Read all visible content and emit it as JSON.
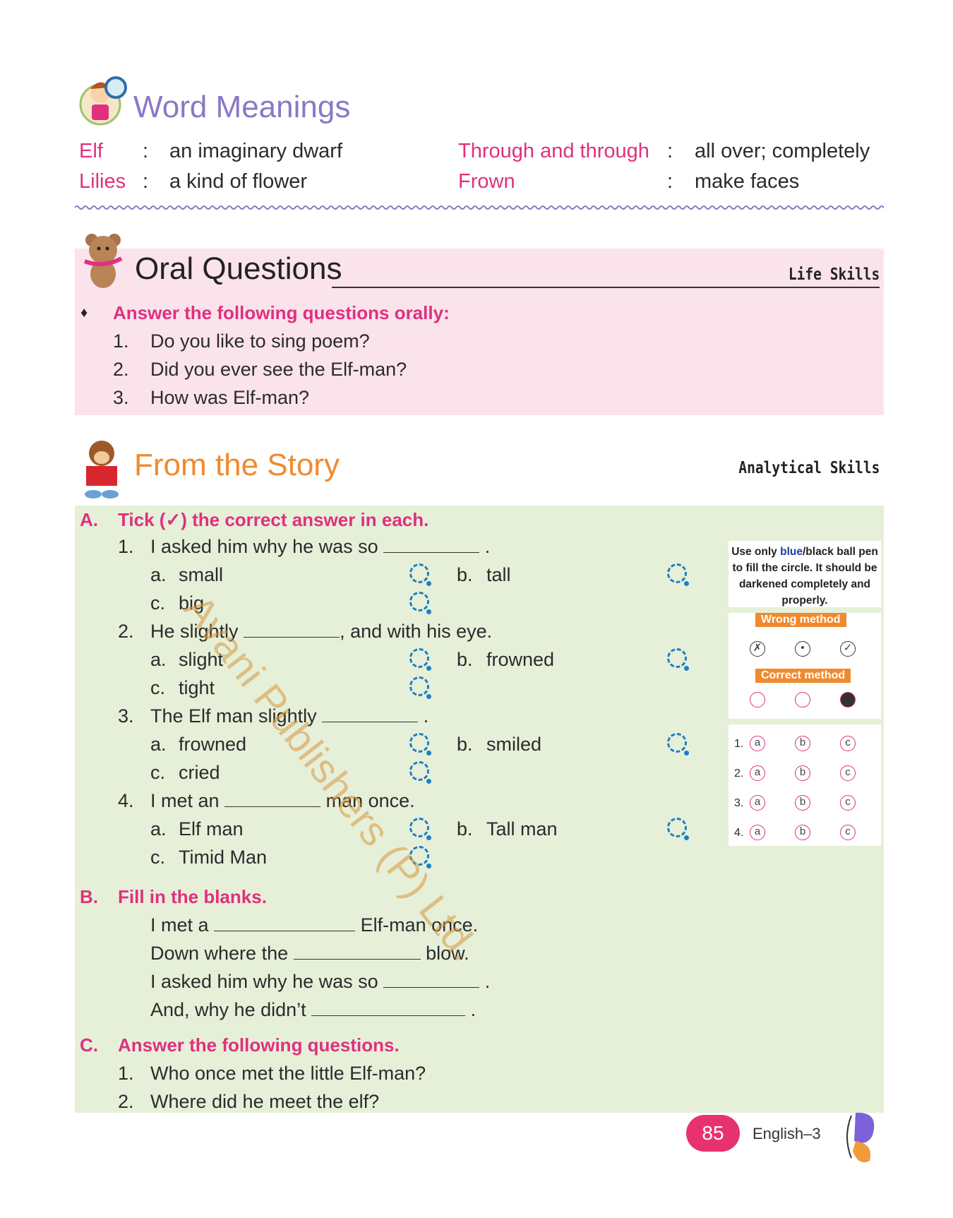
{
  "word_meanings": {
    "title": "Word Meanings",
    "entries": [
      {
        "word": "Elf",
        "sep": ":",
        "meaning": "an imaginary dwarf"
      },
      {
        "word": "Lilies",
        "sep": ":",
        "meaning": "a kind of flower"
      },
      {
        "word": "Through and through",
        "sep": ":",
        "meaning": "all over; completely"
      },
      {
        "word": "Frown",
        "sep": ":",
        "meaning": "make faces"
      }
    ]
  },
  "oral": {
    "title": "Oral Questions",
    "skill": "Life Skills",
    "instruction": "Answer the following questions orally",
    "instruction_colon": ":",
    "bullet": "♦",
    "questions": [
      {
        "num": "1.",
        "text": "Do you like to sing poem?"
      },
      {
        "num": "2.",
        "text": "Did you ever see the Elf-man?"
      },
      {
        "num": "3.",
        "text": "How was Elf-man?"
      }
    ]
  },
  "story": {
    "title": "From the Story",
    "skill": "Analytical Skills",
    "section_a": {
      "letter": "A.",
      "heading": "Tick (✓) the correct answer in each.",
      "items": [
        {
          "num": "1.",
          "pre": "I asked him why he was so",
          "post": ".",
          "options": [
            {
              "l": "a.",
              "t": "small"
            },
            {
              "l": "b.",
              "t": "tall"
            },
            {
              "l": "c.",
              "t": "big"
            }
          ]
        },
        {
          "num": "2.",
          "pre": "He slightly",
          "post": ", and with his eye.",
          "options": [
            {
              "l": "a.",
              "t": "slight"
            },
            {
              "l": "b.",
              "t": "frowned"
            },
            {
              "l": "c.",
              "t": "tight"
            }
          ]
        },
        {
          "num": "3.",
          "pre": "The Elf man slightly",
          "post": ".",
          "options": [
            {
              "l": "a.",
              "t": "frowned"
            },
            {
              "l": "b.",
              "t": "smiled"
            },
            {
              "l": "c.",
              "t": "cried"
            }
          ]
        },
        {
          "num": "4.",
          "pre": "I met an",
          "post": "man once.",
          "options": [
            {
              "l": "a.",
              "t": "Elf man"
            },
            {
              "l": "b.",
              "t": "Tall man"
            },
            {
              "l": "c.",
              "t": "Timid Man"
            }
          ]
        }
      ]
    },
    "section_b": {
      "letter": "B.",
      "heading": "Fill in the blanks.",
      "lines": [
        {
          "pre": "I met a",
          "post": "Elf-man once."
        },
        {
          "pre": "Down where the",
          "post": "blow."
        },
        {
          "pre": "I asked him why he was so",
          "post": "."
        },
        {
          "pre": "And, why he didn’t",
          "post": "."
        }
      ]
    },
    "section_c": {
      "letter": "C.",
      "heading": "Answer the following questions.",
      "questions": [
        {
          "num": "1.",
          "text": "Who once met the little Elf-man?"
        },
        {
          "num": "2.",
          "text": "Where did he meet the elf?"
        }
      ]
    }
  },
  "omr": {
    "note_pre": "Use only ",
    "note_blue": "blue",
    "note_post": "/black ball pen to fill the circle. It should be darkened completely and properly.",
    "wrong_label": "Wrong method",
    "correct_label": "Correct method",
    "wrong_marks": [
      "✗",
      "•",
      "✓"
    ],
    "rows": [
      {
        "num": "1.",
        "opts": [
          "a",
          "b",
          "c"
        ]
      },
      {
        "num": "2.",
        "opts": [
          "a",
          "b",
          "c"
        ]
      },
      {
        "num": "3.",
        "opts": [
          "a",
          "b",
          "c"
        ]
      },
      {
        "num": "4.",
        "opts": [
          "a",
          "b",
          "c"
        ]
      }
    ]
  },
  "watermark": "Avani Publishers (P) Ltd.",
  "footer": {
    "page": "85",
    "book": "English–3"
  },
  "colors": {
    "pink": "#e0307e",
    "orange": "#f08a2e",
    "purple": "#8a78c6",
    "oral_bg": "#fbe3ec",
    "story_bg": "#e6f0d9",
    "circle_blue": "#1d7fc4"
  }
}
